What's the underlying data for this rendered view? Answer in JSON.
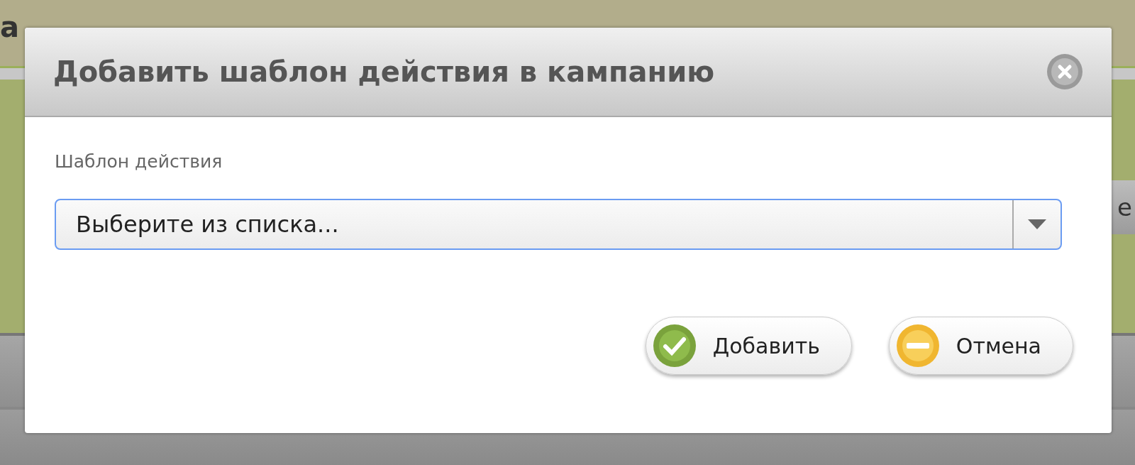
{
  "background": {
    "heading_fragment": "а",
    "tab_fragment": "е"
  },
  "dialog": {
    "title": "Добавить шаблон действия в кампанию",
    "field": {
      "label": "Шаблон действия",
      "placeholder": "Выберите из списка...",
      "focused": true
    },
    "buttons": [
      {
        "kind": "confirm",
        "label": "Добавить"
      },
      {
        "kind": "cancel",
        "label": "Отмена"
      }
    ]
  }
}
